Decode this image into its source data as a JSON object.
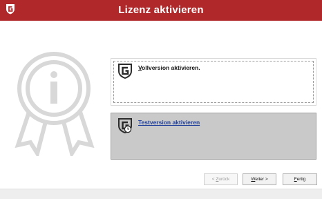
{
  "window": {
    "title": "Lizenz aktivieren",
    "logo_icon": "gdata-shield-icon",
    "accent": "#b0282a"
  },
  "options": {
    "full": {
      "label": "Vollversion aktivieren.",
      "icon": "gdata-shield-icon",
      "selected": false
    },
    "trial": {
      "label": "Testversion aktivieren",
      "icon": "gdata-shield-timer-icon",
      "selected": true
    }
  },
  "buttons": {
    "back": {
      "label": "< Zurück",
      "mnemonic": "Z",
      "enabled": false
    },
    "next": {
      "label": "Weiter >",
      "mnemonic": "W",
      "enabled": true
    },
    "finish": {
      "label": "Fertig",
      "mnemonic": "F",
      "enabled": true
    }
  },
  "decor": {
    "ribbon_icon": "info-award-ribbon-icon"
  }
}
